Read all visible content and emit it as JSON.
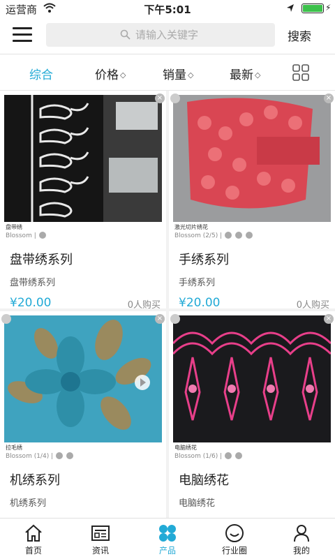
{
  "status": {
    "carrier": "运营商",
    "time": "下午5:01"
  },
  "search": {
    "placeholder": "请输入关键字",
    "button": "搜索"
  },
  "sort": {
    "items": [
      {
        "label": "综合"
      },
      {
        "label": "价格"
      },
      {
        "label": "销量"
      },
      {
        "label": "最新"
      }
    ]
  },
  "products": [
    {
      "title": "盘带绣系列",
      "subtitle": "盘带绣系列",
      "price": "¥20.00",
      "sold": "0人购买",
      "caption": "盘带绣",
      "credit": "Blossom |"
    },
    {
      "title": "手绣系列",
      "subtitle": "手绣系列",
      "price": "¥20.00",
      "sold": "0人购买",
      "caption": "激光切片绣花",
      "credit": "Blossom (2/5) |"
    },
    {
      "title": "机绣系列",
      "subtitle": "机绣系列",
      "price": "",
      "caption": "拉毛绣",
      "credit": "Blossom (1/4) |"
    },
    {
      "title": "电脑绣花",
      "subtitle": "电脑绣花",
      "price": "",
      "caption": "电脑绣花",
      "credit": "Blossom (1/6) |"
    }
  ],
  "tabs": [
    {
      "label": "首页"
    },
    {
      "label": "资讯"
    },
    {
      "label": "产品"
    },
    {
      "label": "行业圈"
    },
    {
      "label": "我的"
    }
  ],
  "colors": {
    "accent": "#22aad6"
  },
  "icons": [
    "menu-icon",
    "search-icon",
    "grid-view-icon",
    "home-icon",
    "news-icon",
    "products-icon",
    "industry-circle-icon",
    "profile-icon"
  ]
}
